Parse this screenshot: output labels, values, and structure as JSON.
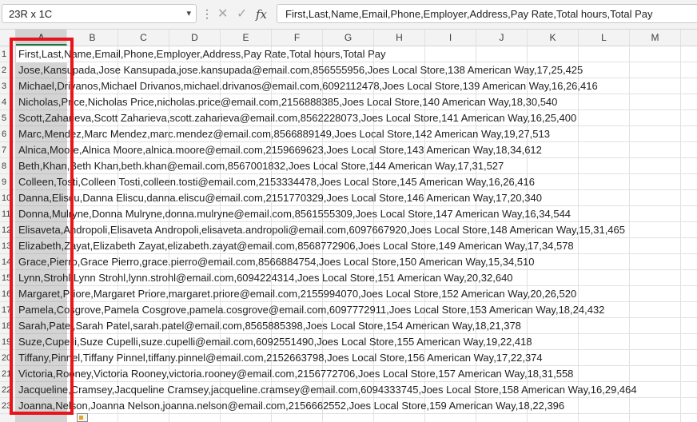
{
  "name_box": {
    "value": "23R x 1C",
    "dropdown_icon": "chevron-down-icon"
  },
  "formula_bar": {
    "separator": "⋮",
    "cancel_icon": "close-icon",
    "confirm_icon": "check-icon",
    "function_label": "fx",
    "content": "First,Last,Name,Email,Phone,Employer,Address,Pay Rate,Total hours,Total Pay"
  },
  "columns": [
    "A",
    "B",
    "C",
    "D",
    "E",
    "F",
    "G",
    "H",
    "I",
    "J",
    "K",
    "L",
    "M"
  ],
  "selected_column": "A",
  "row_numbers": [
    "1",
    "2",
    "3",
    "4",
    "5",
    "6",
    "7",
    "8",
    "9",
    "10",
    "11",
    "12",
    "13",
    "14",
    "15",
    "16",
    "17",
    "18",
    "19",
    "20",
    "21",
    "22",
    "23"
  ],
  "rows": [
    "First,Last,Name,Email,Phone,Employer,Address,Pay Rate,Total hours,Total Pay",
    "Jose,Kansupada,Jose Kansupada,jose.kansupada@email.com,856555956,Joes Local Store,138 American Way,17,25,425",
    "Michael,Drivanos,Michael Drivanos,michael.drivanos@email.com,6092112478,Joes Local Store,139 American Way,16,26,416",
    "Nicholas,Price,Nicholas Price,nicholas.price@email.com,2156888385,Joes Local Store,140 American Way,18,30,540",
    "Scott,Zaharieva,Scott Zaharieva,scott.zaharieva@email.com,8562228073,Joes Local Store,141 American Way,16,25,400",
    "Marc,Mendez,Marc Mendez,marc.mendez@email.com,8566889149,Joes Local Store,142 American Way,19,27,513",
    "Alnica,Moore,Alnica Moore,alnica.moore@email.com,2159669623,Joes Local Store,143 American Way,18,34,612",
    "Beth,Khan,Beth Khan,beth.khan@email.com,8567001832,Joes Local Store,144 American Way,17,31,527",
    "Colleen,Tosti,Colleen Tosti,colleen.tosti@email.com,2153334478,Joes Local Store,145 American Way,16,26,416",
    "Danna,Eliscu,Danna Eliscu,danna.eliscu@email.com,2151770329,Joes Local Store,146 American Way,17,20,340",
    "Donna,Mulryne,Donna Mulryne,donna.mulryne@email.com,8561555309,Joes Local Store,147 American Way,16,34,544",
    "Elisaveta,Andropoli,Elisaveta Andropoli,elisaveta.andropoli@email.com,6097667920,Joes Local Store,148 American Way,15,31,465",
    "Elizabeth,Zayat,Elizabeth Zayat,elizabeth.zayat@email.com,8568772906,Joes Local Store,149 American Way,17,34,578",
    "Grace,Pierro,Grace Pierro,grace.pierro@email.com,8566884754,Joes Local Store,150 American Way,15,34,510",
    "Lynn,Strohl,Lynn Strohl,lynn.strohl@email.com,6094224314,Joes Local Store,151 American Way,20,32,640",
    "Margaret,Priore,Margaret Priore,margaret.priore@email.com,2155994070,Joes Local Store,152 American Way,20,26,520",
    "Pamela,Cosgrove,Pamela Cosgrove,pamela.cosgrove@email.com,6097772911,Joes Local Store,153 American Way,18,24,432",
    "Sarah,Patel,Sarah Patel,sarah.patel@email.com,8565885398,Joes Local Store,154 American Way,18,21,378",
    "Suze,Cupelli,Suze Cupelli,suze.cupelli@email.com,6092551490,Joes Local Store,155 American Way,19,22,418",
    "Tiffany,Pinnel,Tiffany Pinnel,tiffany.pinnel@email.com,2152663798,Joes Local Store,156 American Way,17,22,374",
    "Victoria,Rooney,Victoria Rooney,victoria.rooney@email.com,2156772706,Joes Local Store,157 American Way,18,31,558",
    "Jacqueline,Cramsey,Jacqueline Cramsey,jacqueline.cramsey@email.com,6094333745,Joes Local Store,158 American Way,16,29,464",
    "Joanna,Nelson,Joanna Nelson,joanna.nelson@email.com,2156662552,Joes Local Store,159 American Way,18,22,396"
  ],
  "colors": {
    "highlight": "#e8141b",
    "selection": "#d4d4d4",
    "accent": "#217346"
  },
  "paste_options_icon": "clipboard-icon"
}
